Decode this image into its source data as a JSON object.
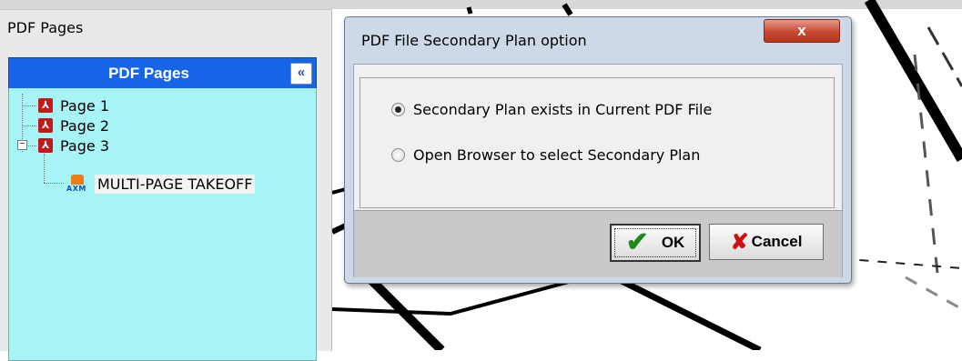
{
  "left_panel": {
    "title": "PDF Pages",
    "header": {
      "title": "PDF Pages",
      "collapse_icon": "«"
    },
    "tree": [
      {
        "label": "Page 1",
        "icon": "pdf-icon"
      },
      {
        "label": "Page 2",
        "icon": "pdf-icon"
      },
      {
        "label": "Page 3",
        "icon": "pdf-icon",
        "expanded": true,
        "children": [
          {
            "label": "MULTI-PAGE TAKEOFF",
            "icon": "takeoff-icon",
            "icon_text": "AXM"
          }
        ]
      }
    ],
    "expander_symbol": "−"
  },
  "dialog": {
    "title": "PDF File Secondary Plan option",
    "close_symbol": "x",
    "options": [
      {
        "label": "Secondary Plan exists in Current PDF File",
        "checked": true
      },
      {
        "label": "Open Browser to select Secondary Plan",
        "checked": false
      }
    ],
    "ok_label": "OK",
    "cancel_label": "Cancel"
  },
  "colors": {
    "pane_header": "#1565e6",
    "tree_background": "#a6f4f6",
    "close_button": "#c64a33",
    "ok_check": "#1c8b1c",
    "cancel_x": "#d01010"
  }
}
